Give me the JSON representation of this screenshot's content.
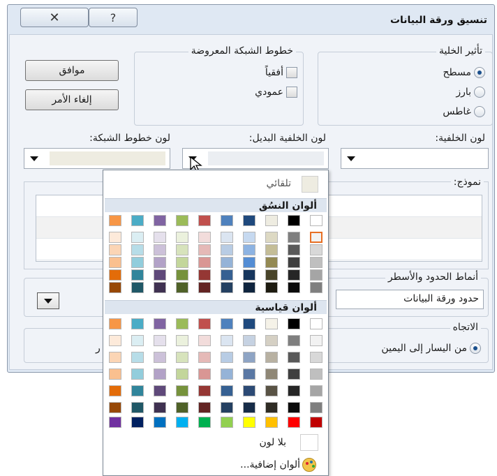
{
  "window": {
    "title": "تنسيق ورقة البيانات",
    "close_glyph": "✕",
    "help_glyph": "?"
  },
  "cell_effect": {
    "legend": "تأثير الخلية",
    "options": [
      "مسطح",
      "بارز",
      "غاطس"
    ],
    "selected_index": 0
  },
  "gridlines": {
    "legend": "خطوط الشبكة المعروضة",
    "horizontal": "أفقياً",
    "vertical": "عمودي"
  },
  "buttons": {
    "ok": "موافق",
    "cancel": "إلغاء الأمر"
  },
  "labels": {
    "background_color": "لون الخلفية:",
    "alt_background_color": "لون الخلفية البديل:",
    "gridline_color": "لون خطوط الشبكة:",
    "sample": "نموذج:",
    "border_styles": "أنماط الحدود والأسطر",
    "direction": "الاتجاه"
  },
  "border_style_value": "حدود ورقة البيانات",
  "direction_option": "من اليسار إلى اليمين",
  "direction_option_clipped": "ر",
  "color_popup": {
    "automatic": "تلقائي",
    "theme_colors": "ألوان النسُق",
    "standard_colors": "ألوان قياسية",
    "no_color": "بلا لون",
    "more_colors": "ألوان إضافية...",
    "theme_top_row": [
      "#ffffff",
      "#000000",
      "#eeece1",
      "#1f497d",
      "#4f81bd",
      "#c0504d",
      "#9bbb59",
      "#8064a2",
      "#4bacc6",
      "#f79646"
    ],
    "theme_shades": [
      [
        "#f2f2f2",
        "#7f7f7f",
        "#ddd9c3",
        "#c6d9f0",
        "#dbe5f1",
        "#f2dcdb",
        "#ebf1dd",
        "#e5e0ec",
        "#dbeef3",
        "#fdeada"
      ],
      [
        "#d8d8d8",
        "#595959",
        "#c4bd97",
        "#8db3e2",
        "#b8cce4",
        "#e5b9b7",
        "#d7e3bc",
        "#ccc1d9",
        "#b7dde8",
        "#fbd5b5"
      ],
      [
        "#bfbfbf",
        "#3f3f3f",
        "#938953",
        "#548dd4",
        "#95b3d7",
        "#d99694",
        "#c3d69b",
        "#b2a2c7",
        "#92cddc",
        "#fac08f"
      ],
      [
        "#a5a5a5",
        "#262626",
        "#494429",
        "#17365d",
        "#366092",
        "#953734",
        "#76923c",
        "#5f497a",
        "#31859b",
        "#e36c09"
      ],
      [
        "#7f7f7f",
        "#0c0c0c",
        "#1d1b10",
        "#0f243e",
        "#244061",
        "#632423",
        "#4f6128",
        "#3f3151",
        "#205867",
        "#974806"
      ]
    ],
    "standard_top_row": [
      "#ffffff",
      "#000000",
      "#f5f2e8",
      "#1f497d",
      "#4f81bd",
      "#c0504d",
      "#9bbb59",
      "#8064a2",
      "#4bacc6",
      "#f79646"
    ],
    "standard_rows": [
      [
        "#f2f2f2",
        "#7f7f7f",
        "#d5d0c4",
        "#c6d2e2",
        "#dbe5f1",
        "#f2dcdb",
        "#ebf1dd",
        "#e5e0ec",
        "#dbeef3",
        "#fdeada"
      ],
      [
        "#d8d8d8",
        "#595959",
        "#b8b1a2",
        "#8ea4c4",
        "#b8cce4",
        "#e5b9b7",
        "#d7e3bc",
        "#ccc1d9",
        "#b7dde8",
        "#fbd5b5"
      ],
      [
        "#bfbfbf",
        "#3f3f3f",
        "#8f8776",
        "#5a78a4",
        "#95b3d7",
        "#d99694",
        "#c3d69b",
        "#b2a2c7",
        "#92cddc",
        "#fac08f"
      ],
      [
        "#a5a5a5",
        "#262626",
        "#595345",
        "#2c4a75",
        "#366092",
        "#953734",
        "#76923c",
        "#5f497a",
        "#31859b",
        "#e36c09"
      ],
      [
        "#7f7f7f",
        "#0c0c0c",
        "#2f2c24",
        "#172c48",
        "#244061",
        "#632423",
        "#4f6128",
        "#3f3151",
        "#205867",
        "#974806"
      ]
    ],
    "standard_bright": [
      "#c00000",
      "#ff0000",
      "#ffc000",
      "#ffff00",
      "#92d050",
      "#00b050",
      "#00b0f0",
      "#0070c0",
      "#002060",
      "#7030a0"
    ]
  }
}
